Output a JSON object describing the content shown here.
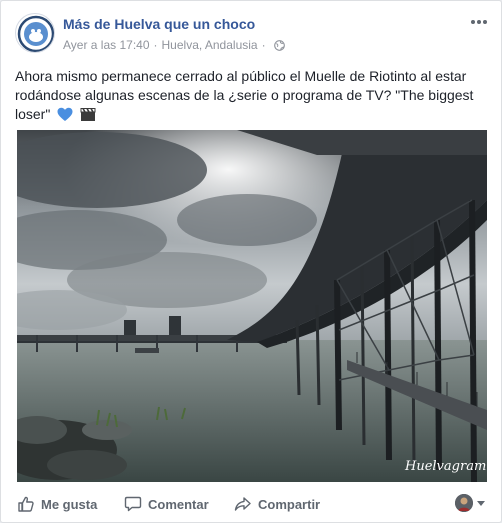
{
  "post": {
    "page_name": "Más de Huelva que un choco",
    "timestamp": "Ayer a las 17:40",
    "separator": "·",
    "location": "Huelva, Andalusia",
    "audience_icon": "globe-icon",
    "text": "Ahora mismo permanece cerrado al público el Muelle de Riotinto al estar rodándose algunas escenas de la ¿serie o programa de TV? \"The biggest loser\"",
    "emojis": [
      "blue-heart",
      "clapper-board"
    ]
  },
  "photo": {
    "watermark": "Huelvagram"
  },
  "actions": {
    "like_label": "Me gusta",
    "comment_label": "Comentar",
    "share_label": "Compartir"
  },
  "colors": {
    "link_blue": "#365899",
    "meta_gray": "#90949c",
    "action_gray": "#606770",
    "text": "#1d2129"
  }
}
